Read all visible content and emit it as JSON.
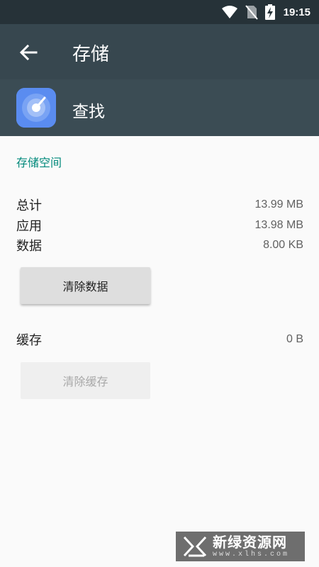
{
  "status_bar": {
    "time": "19:15",
    "icons": [
      "wifi-icon",
      "no-sim-icon",
      "battery-charging-icon"
    ]
  },
  "app_bar": {
    "title": "存储",
    "back_icon": "arrow-back-icon"
  },
  "app_header": {
    "app_name": "查找",
    "app_icon": "radar-app-icon",
    "icon_color": "#5a8cf0"
  },
  "storage": {
    "section_title": "存储空间",
    "rows": [
      {
        "label": "总计",
        "value": "13.99 MB"
      },
      {
        "label": "应用",
        "value": "13.98 MB"
      },
      {
        "label": "数据",
        "value": "8.00 KB"
      }
    ],
    "clear_data_button": "清除数据"
  },
  "cache": {
    "label": "缓存",
    "value": "0 B",
    "clear_cache_button": "清除缓存",
    "clear_cache_enabled": false
  },
  "watermark": {
    "text_cn": "新绿资源网",
    "text_en": "www.xlhs.com"
  },
  "colors": {
    "status_bar": "#263238",
    "app_bar": "#37474f",
    "accent": "#00897b",
    "background": "#fafafa"
  }
}
